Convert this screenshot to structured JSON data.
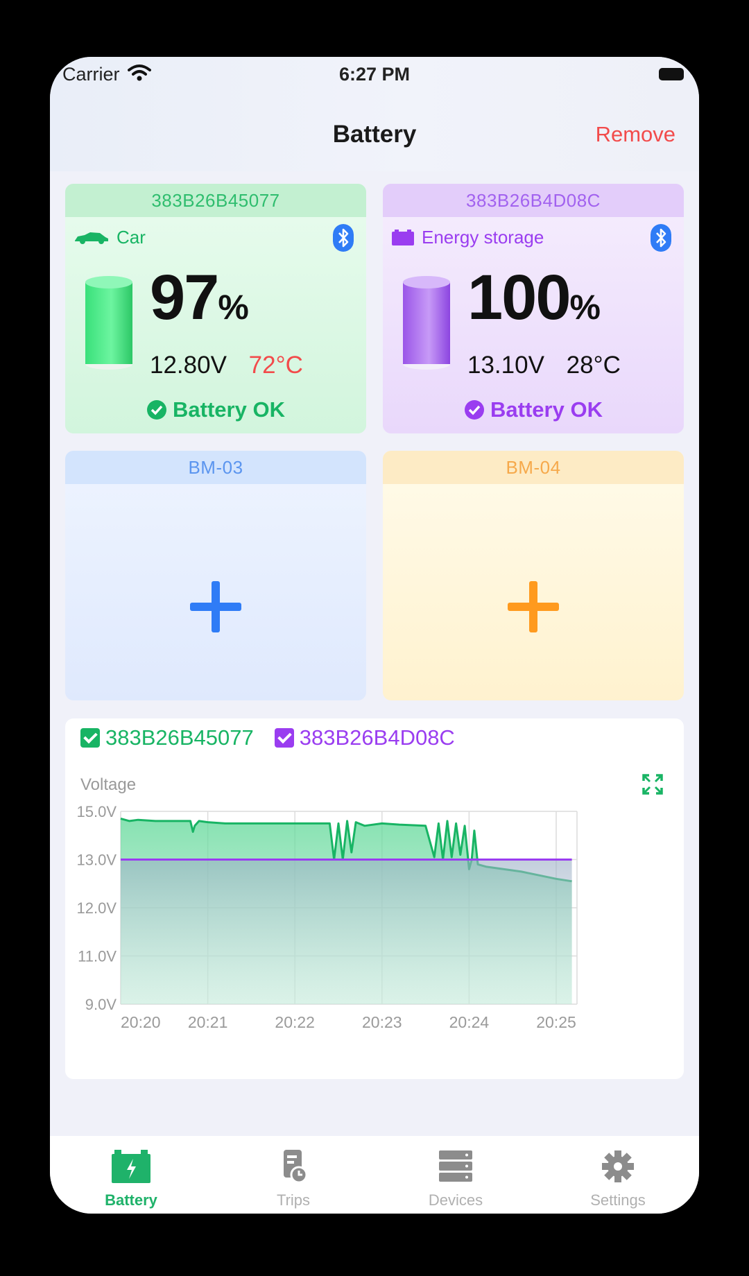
{
  "status_bar": {
    "carrier": "Carrier",
    "time": "6:27 PM"
  },
  "nav": {
    "title": "Battery",
    "remove_label": "Remove"
  },
  "colors": {
    "green": "#18b464",
    "purple": "#9a3df0",
    "blue": "#2f7cf6",
    "orange": "#ff9a1e",
    "red": "#f24b4b"
  },
  "cards": [
    {
      "id": "383B26B45077",
      "type_label": "Car",
      "type_icon": "car-icon",
      "percent": "97",
      "percent_unit": "%",
      "voltage": "12.80V",
      "temperature": "72°C",
      "status": "Battery OK"
    },
    {
      "id": "383B26B4D08C",
      "type_label": "Energy storage",
      "type_icon": "energy-storage-icon",
      "percent": "100",
      "percent_unit": "%",
      "voltage": "13.10V",
      "temperature": "28°C",
      "status": "Battery OK"
    },
    {
      "id": "BM-03"
    },
    {
      "id": "BM-04"
    }
  ],
  "chart": {
    "legend": [
      "383B26B45077",
      "383B26B4D08C"
    ],
    "label": "Voltage"
  },
  "chart_data": {
    "type": "area",
    "ylabel": "Voltage",
    "y_ticks": [
      "15.0V",
      "13.0V",
      "12.0V",
      "11.0V",
      "9.0V"
    ],
    "x_ticks": [
      "20:20",
      "20:21",
      "20:22",
      "20:23",
      "20:24",
      "20:25"
    ],
    "series": [
      {
        "name": "383B26B45077",
        "color": "#18b464",
        "x": [
          0,
          0.1,
          0.2,
          0.4,
          0.8,
          0.83,
          0.85,
          0.9,
          1.0,
          1.2,
          1.6,
          2.0,
          2.4,
          2.45,
          2.5,
          2.55,
          2.6,
          2.65,
          2.7,
          2.8,
          3.0,
          3.2,
          3.5,
          3.6,
          3.65,
          3.7,
          3.75,
          3.8,
          3.85,
          3.9,
          3.95,
          4.0,
          4.03,
          4.06,
          4.1,
          4.2,
          4.6,
          5.0,
          5.18
        ],
        "values": [
          14.7,
          14.6,
          14.65,
          14.6,
          14.6,
          14.15,
          14.4,
          14.6,
          14.55,
          14.5,
          14.5,
          14.5,
          14.5,
          13.0,
          14.5,
          13.0,
          14.6,
          13.3,
          14.55,
          14.4,
          14.5,
          14.45,
          14.4,
          13.1,
          14.5,
          13.0,
          14.6,
          13.1,
          14.5,
          13.2,
          14.4,
          12.8,
          13.0,
          14.2,
          12.9,
          12.85,
          12.75,
          12.6,
          12.55
        ]
      },
      {
        "name": "383B26B4D08C",
        "color": "#9a3df0",
        "x": [
          0,
          1,
          2,
          3,
          4,
          4.3,
          4.6,
          5.18
        ],
        "values": [
          13.0,
          13.0,
          13.0,
          13.0,
          13.0,
          13.0,
          13.0,
          13.0
        ]
      }
    ]
  },
  "tabs": [
    {
      "label": "Battery",
      "icon": "battery-tab-icon",
      "active": true
    },
    {
      "label": "Trips",
      "icon": "trips-tab-icon"
    },
    {
      "label": "Devices",
      "icon": "devices-tab-icon"
    },
    {
      "label": "Settings",
      "icon": "settings-tab-icon"
    }
  ]
}
